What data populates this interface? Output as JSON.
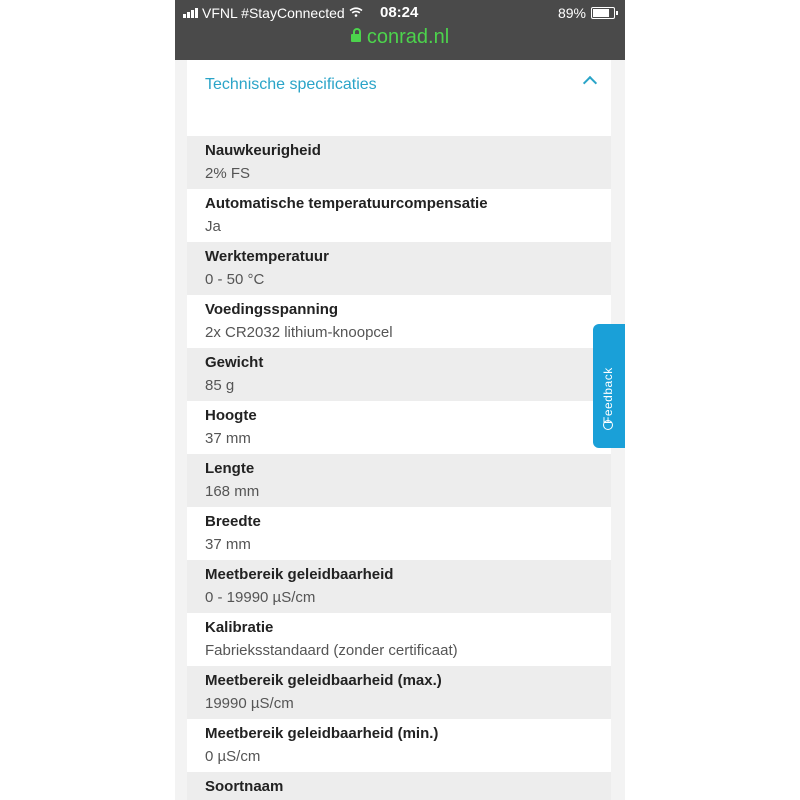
{
  "status_bar": {
    "carrier": "VFNL #StayConnected",
    "time": "08:24",
    "battery_level": 0.89,
    "battery_text": "89%",
    "signal_icon": "signal-bars-icon",
    "wifi_icon": "wifi-icon"
  },
  "browser": {
    "url": "conrad.nl",
    "lock_icon": "lock-icon",
    "url_color": "#4cd34c"
  },
  "section": {
    "title": "Technische specificaties",
    "toggle_icon": "chevron-up-icon",
    "accent": "#2aa4c8"
  },
  "specs": [
    {
      "label": "Nauwkeurigheid",
      "value": "2% FS"
    },
    {
      "label": "Automatische temperatuurcompensatie",
      "value": "Ja"
    },
    {
      "label": "Werktemperatuur",
      "value": "0 - 50 °C"
    },
    {
      "label": "Voedingsspanning",
      "value": "2x CR2032 lithium-knoopcel"
    },
    {
      "label": "Gewicht",
      "value": "85 g"
    },
    {
      "label": "Hoogte",
      "value": "37 mm"
    },
    {
      "label": "Lengte",
      "value": "168 mm"
    },
    {
      "label": "Breedte",
      "value": "37 mm"
    },
    {
      "label": "Meetbereik geleidbaarheid",
      "value": "0 - 19990 µS/cm"
    },
    {
      "label": "Kalibratie",
      "value": "Fabrieksstandaard (zonder certificaat)"
    },
    {
      "label": "Meetbereik geleidbaarheid (max.)",
      "value": "19990 µS/cm"
    },
    {
      "label": "Meetbereik geleidbaarheid (min.)",
      "value": "0 µS/cm"
    },
    {
      "label": "Soortnaam",
      "value": ""
    }
  ],
  "feedback": {
    "label": "Feedback",
    "icon": "chat-bubble-icon",
    "color": "#1aa0d8"
  }
}
